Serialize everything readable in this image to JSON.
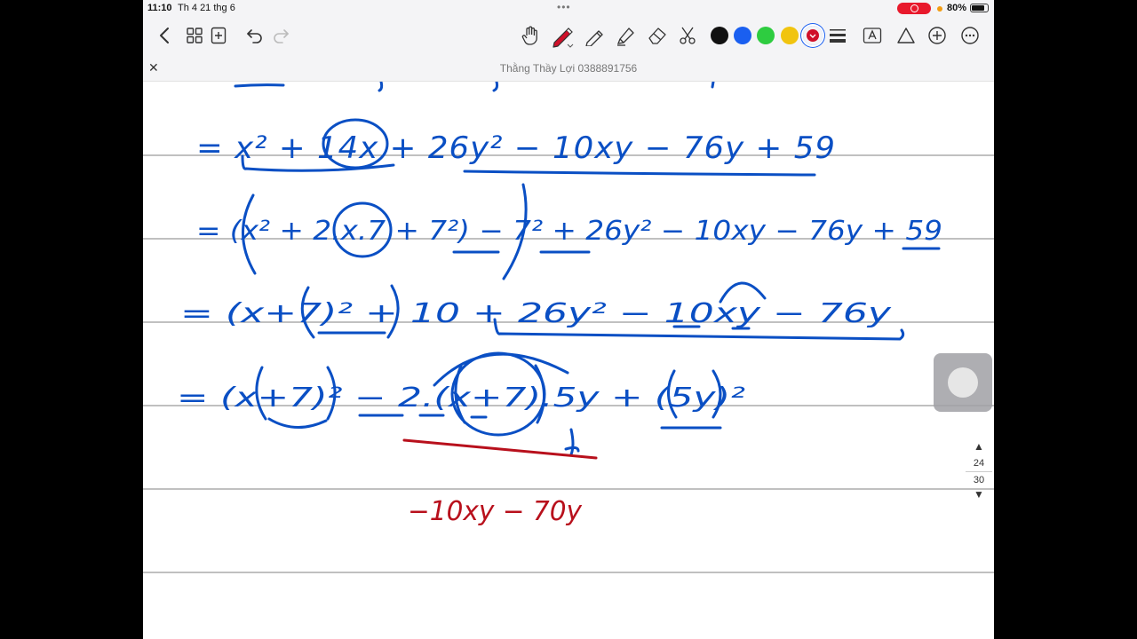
{
  "status": {
    "time": "11:10",
    "date": "Th 4 21 thg 6",
    "battery": "80%"
  },
  "toolbar": {
    "icons": [
      "back-icon",
      "grid-icon",
      "add-page-icon",
      "undo-icon",
      "redo-icon",
      "hand-icon",
      "pen-icon",
      "pencil-icon",
      "highlighter-icon",
      "eraser-icon",
      "lasso-icon",
      "text-box-icon",
      "shape-icon",
      "add-icon",
      "more-icon"
    ],
    "colors": [
      "#111111",
      "#1a5ff0",
      "#2ecc40",
      "#f1c40f",
      "#1a5ff0"
    ],
    "pen_color": "#d0102a"
  },
  "document": {
    "title": "Thằng Thầy Lợi 0388891756"
  },
  "ink": {
    "line1": "= x² + 14x + 26y² − 10xy − 76y + 59",
    "line2": "= (x² + 2.x.7 + 7²) − 7² + 26y² − 10xy − 76y + 59",
    "line3": "= (x+7)² + 10 + 26y² − 10xy − 76y",
    "line4": "= (x+7)² − 2.(x+7).5y + (5y)²",
    "line5": "−10xy − 70y",
    "blue": "#0a4fc4",
    "red": "#b8101c"
  },
  "pager": {
    "current": "24",
    "total": "30"
  }
}
